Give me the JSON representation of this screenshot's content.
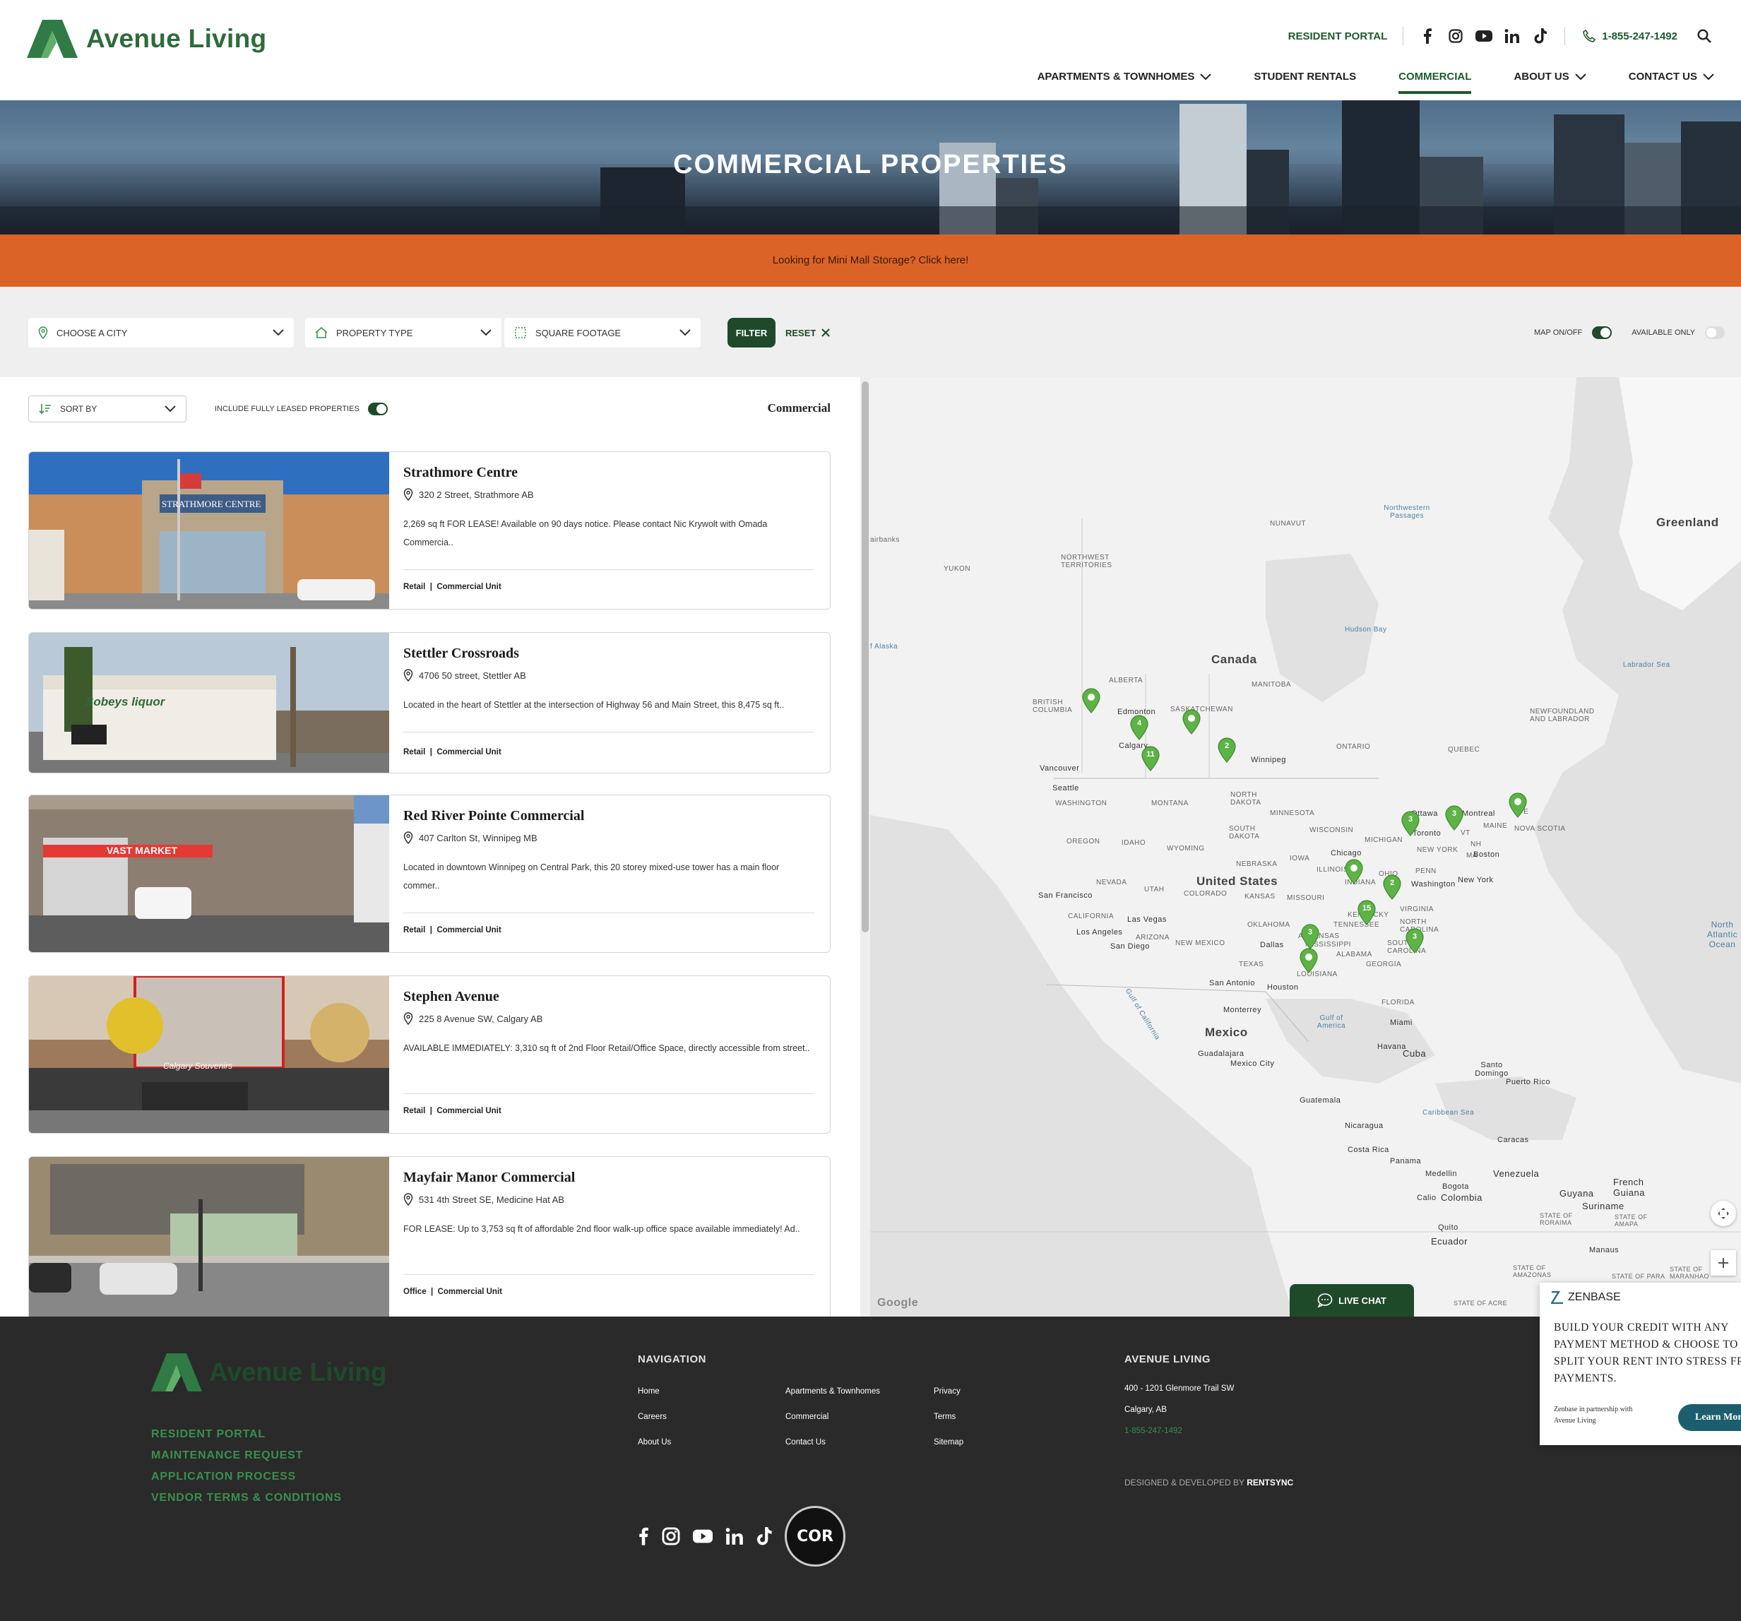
{
  "brand": {
    "name": "Avenue Living",
    "accent": "#1f5a2e",
    "green": "#3a8f4c",
    "orange": "#dc6327"
  },
  "topbar": {
    "resident_portal": "RESIDENT PORTAL",
    "phone": "1-855-247-1492"
  },
  "nav": {
    "items": [
      {
        "label": "APARTMENTS & TOWNHOMES",
        "dropdown": true
      },
      {
        "label": "STUDENT RENTALS",
        "dropdown": false
      },
      {
        "label": "COMMERCIAL",
        "dropdown": false,
        "active": true
      },
      {
        "label": "ABOUT US",
        "dropdown": true
      },
      {
        "label": "CONTACT US",
        "dropdown": true
      }
    ]
  },
  "hero": {
    "title": "COMMERCIAL PROPERTIES"
  },
  "promo": {
    "text": "Looking for Mini Mall Storage? Click here!"
  },
  "filters": {
    "city": "CHOOSE A CITY",
    "property_type": "PROPERTY TYPE",
    "square_footage": "SQUARE FOOTAGE",
    "filter_label": "FILTER",
    "reset_label": "RESET",
    "map_toggle": "MAP ON/OFF",
    "map_on": true,
    "available_only": "AVAILABLE ONLY",
    "available_on": false
  },
  "list": {
    "sort_by": "SORT BY",
    "include_leased": "INCLUDE FULLY LEASED PROPERTIES",
    "include_leased_on": true,
    "heading": "Commercial",
    "properties": [
      {
        "name": "Strathmore Centre",
        "address": "320 2 Street, Strathmore AB",
        "description": "2,269 sq ft FOR LEASE! Available on 90 days notice. Please contact Nic Krywolt with Omada Commercia..",
        "tags": [
          "Retail",
          "Commercial Unit"
        ],
        "sign": "STRATHMORE CENTRE"
      },
      {
        "name": "Stettler Crossroads",
        "address": "4706 50 street, Stettler AB",
        "description": "Located in the heart of Stettler at the intersection of Highway 56 and Main Street, this 8,475 sq ft..",
        "tags": [
          "Retail",
          "Commercial Unit"
        ],
        "sign": "Sobeys liquor"
      },
      {
        "name": "Red River Pointe Commercial",
        "address": "407 Carlton St, Winnipeg MB",
        "description": "Located in downtown Winnipeg on Central Park, this 20 storey mixed-use tower has a main floor commer..",
        "tags": [
          "Retail",
          "Commercial Unit"
        ],
        "sign": "VAST MARKET"
      },
      {
        "name": "Stephen Avenue",
        "address": "225 8 Avenue SW, Calgary AB",
        "description": "AVAILABLE IMMEDIATELY: 3,310 sq ft of 2nd Floor Retail/Office Space, directly accessible from street..",
        "tags": [
          "Retail",
          "Commercial Unit"
        ],
        "sign": "Calgary Souvenirs"
      },
      {
        "name": "Mayfair Manor Commercial",
        "address": "531 4th Street SE, Medicine Hat AB",
        "description": "FOR LEASE: Up to 3,753 sq ft of affordable 2nd floor walk-up office space available immediately! Ad..",
        "tags": [
          "Office",
          "Commercial Unit"
        ],
        "sign": ""
      }
    ]
  },
  "map": {
    "labels": {
      "greenland": "Greenland",
      "nunavut": "NUNAVUT",
      "nw_passages": "Northwestern Passages",
      "nwt": "NORTHWEST TERRITORIES",
      "yukon": "YUKON",
      "fairbanks": "airbanks",
      "alaska_gulf": "f Alaska",
      "hudson": "Hudson Bay",
      "labrador_sea": "Labrador Sea",
      "canada": "Canada",
      "bc": "BRITISH COLUMBIA",
      "alberta": "ALBERTA",
      "sask": "SASKATCHEWAN",
      "manitoba": "MANITOBA",
      "ontario": "ONTARIO",
      "quebec": "QUEBEC",
      "newfoundland": "NEWFOUNDLAND AND LABRADOR",
      "edmonton": "Edmonton",
      "calgary": "Calgary",
      "winnipeg": "Winnipeg",
      "vancouver": "Vancouver",
      "seattle": "Seattle",
      "washington_state": "WASHINGTON",
      "montana": "MONTANA",
      "north_dakota": "NORTH DAKOTA",
      "minnesota": "MINNESOTA",
      "ottawa": "Ottawa",
      "toronto": "Toronto",
      "montreal": "Montreal",
      "maine": "MAINE",
      "nova_scotia": "NOVA SCOTIA",
      "pe": "PE",
      "vt": "VT",
      "nh": "NH",
      "ma": "MA",
      "oregon": "OREGON",
      "idaho": "IDAHO",
      "wyoming": "WYOMING",
      "south_dakota": "SOUTH DAKOTA",
      "wisconsin": "WISCONSIN",
      "michigan": "MICHIGAN",
      "new_york_state": "NEW YORK",
      "boston": "Boston",
      "nebraska": "NEBRASKA",
      "iowa": "IOWA",
      "chicago": "Chicago",
      "illinois": "ILLINOIS",
      "indiana": "INDIANA",
      "ohio": "OHIO",
      "penn": "PENN",
      "new_york": "New York",
      "washington_dc": "Washington",
      "nevada": "NEVADA",
      "utah": "UTAH",
      "colorado": "COLORADO",
      "united_states": "United States",
      "kansas": "KANSAS",
      "missouri": "MISSOURI",
      "kentucky": "KENTUCKY",
      "virginia": "VIRGINIA",
      "san_francisco": "San Francisco",
      "california": "CALIFORNIA",
      "las_vegas": "Las Vegas",
      "los_angeles": "Los Angeles",
      "arizona": "ARIZONA",
      "san_diego": "San Diego",
      "new_mexico": "NEW MEXICO",
      "oklahoma": "OKLAHOMA",
      "tennessee": "TENNESSEE",
      "north_carolina": "NORTH CAROLINA",
      "south_carolina": "SOUTH CAROLINA",
      "arkansas": "ARKANSAS",
      "mississippi": "MISSISSIPPI",
      "alabama": "ALABAMA",
      "georgia": "GEORGIA",
      "texas": "TEXAS",
      "dallas": "Dallas",
      "louisiana": "LOUISIANA",
      "san_antonio": "San Antonio",
      "houston": "Houston",
      "florida": "FLORIDA",
      "miami": "Miami",
      "gulf_california": "Gulf of California",
      "gulf_mexico": "Gulf of America",
      "monterrey": "Monterrey",
      "mexico": "Mexico",
      "guadalajara": "Guadalajara",
      "mexico_city": "Mexico City",
      "havana": "Havana",
      "cuba": "Cuba",
      "santo_domingo": "Santo Domingo",
      "puerto_rico": "Puerto Rico",
      "guatemala": "Guatemala",
      "caribbean": "Caribbean Sea",
      "nicaragua": "Nicaragua",
      "costa_rica": "Costa Rica",
      "panama": "Panama",
      "caracas": "Caracas",
      "venezuela": "Venezuela",
      "medellin": "Medellin",
      "bogota": "Bogota",
      "cali": "Calio",
      "colombia": "Colombia",
      "guyana": "Guyana",
      "suriname": "Suriname",
      "french_guiana": "French Guiana",
      "quito": "Quito",
      "ecuador": "Ecuador",
      "manaus": "Manaus",
      "north_atlantic": "North Atlantic Ocean",
      "roraima": "STATE OF RORAIMA",
      "amapa": "STATE OF AMAPA",
      "amazonas": "STATE OF AMAZONAS",
      "para": "STATE OF PARA",
      "maranhao": "STATE OF MARANHAO",
      "acre": "STATE OF ACRE",
      "google": "Google"
    },
    "clusters": [
      "",
      "4",
      "",
      "11",
      "2",
      "3",
      "3",
      "",
      "",
      "2",
      "15",
      "3",
      "3",
      "",
      "3"
    ],
    "live_chat": "LIVE CHAT"
  },
  "zenbase": {
    "brand": "ZENBASE",
    "headline": "BUILD YOUR CREDIT WITH ANY PAYMENT METHOD & CHOOSE TO SPLIT YOUR RENT INTO STRESS FREE PAYMENTS.",
    "note": "Zenbase in partnership with Avenue Living",
    "button": "Learn More"
  },
  "footer": {
    "brand_name": "Avenue Living",
    "quick_links": [
      "RESIDENT PORTAL",
      "MAINTENANCE REQUEST",
      "APPLICATION PROCESS",
      "VENDOR TERMS & CONDITIONS"
    ],
    "nav_heading": "NAVIGATION",
    "nav_col1": [
      "Home",
      "Careers",
      "About Us"
    ],
    "nav_col2": [
      "Apartments & Townhomes",
      "Commercial",
      "Contact Us"
    ],
    "nav_col3": [
      "Privacy",
      "Terms",
      "Sitemap"
    ],
    "company_heading": "AVENUE LIVING",
    "address1": "400 - 1201 Glenmore Trail SW",
    "address2": "Calgary, AB",
    "phone": "1-855-247-1492",
    "credit_prefix": "DESIGNED & DEVELOPED BY",
    "credit_brand": "RENTSYNC",
    "badge": "COR"
  }
}
